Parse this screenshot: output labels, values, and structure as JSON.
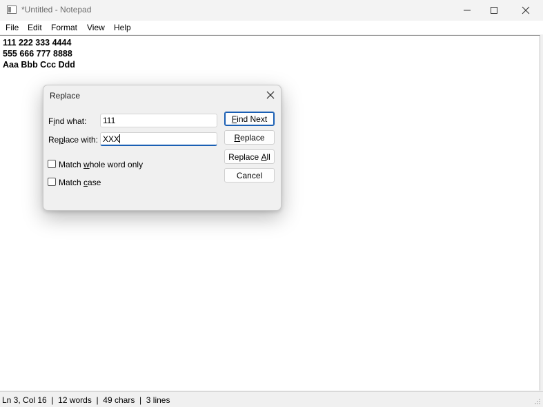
{
  "window": {
    "title": "*Untitled - Notepad",
    "icon": "notepad-icon"
  },
  "menu": [
    "File",
    "Edit",
    "Format",
    "View",
    "Help"
  ],
  "editor": {
    "lines": [
      "111 222 333 4444",
      "555 666 777 8888",
      "Aaa Bbb Ccc Ddd"
    ]
  },
  "dialog": {
    "title": "Replace",
    "find_label_pre": "F",
    "find_label_u": "i",
    "find_label_post": "nd what:",
    "find_value": "111",
    "replace_label_pre": "Re",
    "replace_label_u": "p",
    "replace_label_post": "lace with:",
    "replace_value": "XXX",
    "buttons": {
      "find_next_u": "F",
      "find_next_post": "ind Next",
      "replace_u": "R",
      "replace_post": "eplace",
      "replace_all_pre": "Replace ",
      "replace_all_u": "A",
      "replace_all_post": "ll",
      "cancel": "Cancel"
    },
    "checkboxes": {
      "whole_word_pre": "Match ",
      "whole_word_u": "w",
      "whole_word_post": "hole word only",
      "whole_word_checked": false,
      "match_case_pre": "Match ",
      "match_case_u": "c",
      "match_case_post": "ase",
      "match_case_checked": false
    }
  },
  "status": {
    "text": "Ln 3, Col 16  |  12 words  |  49 chars  |  3 lines"
  },
  "colors": {
    "accent": "#1a5fb4",
    "title_text": "#6b6b6b"
  }
}
